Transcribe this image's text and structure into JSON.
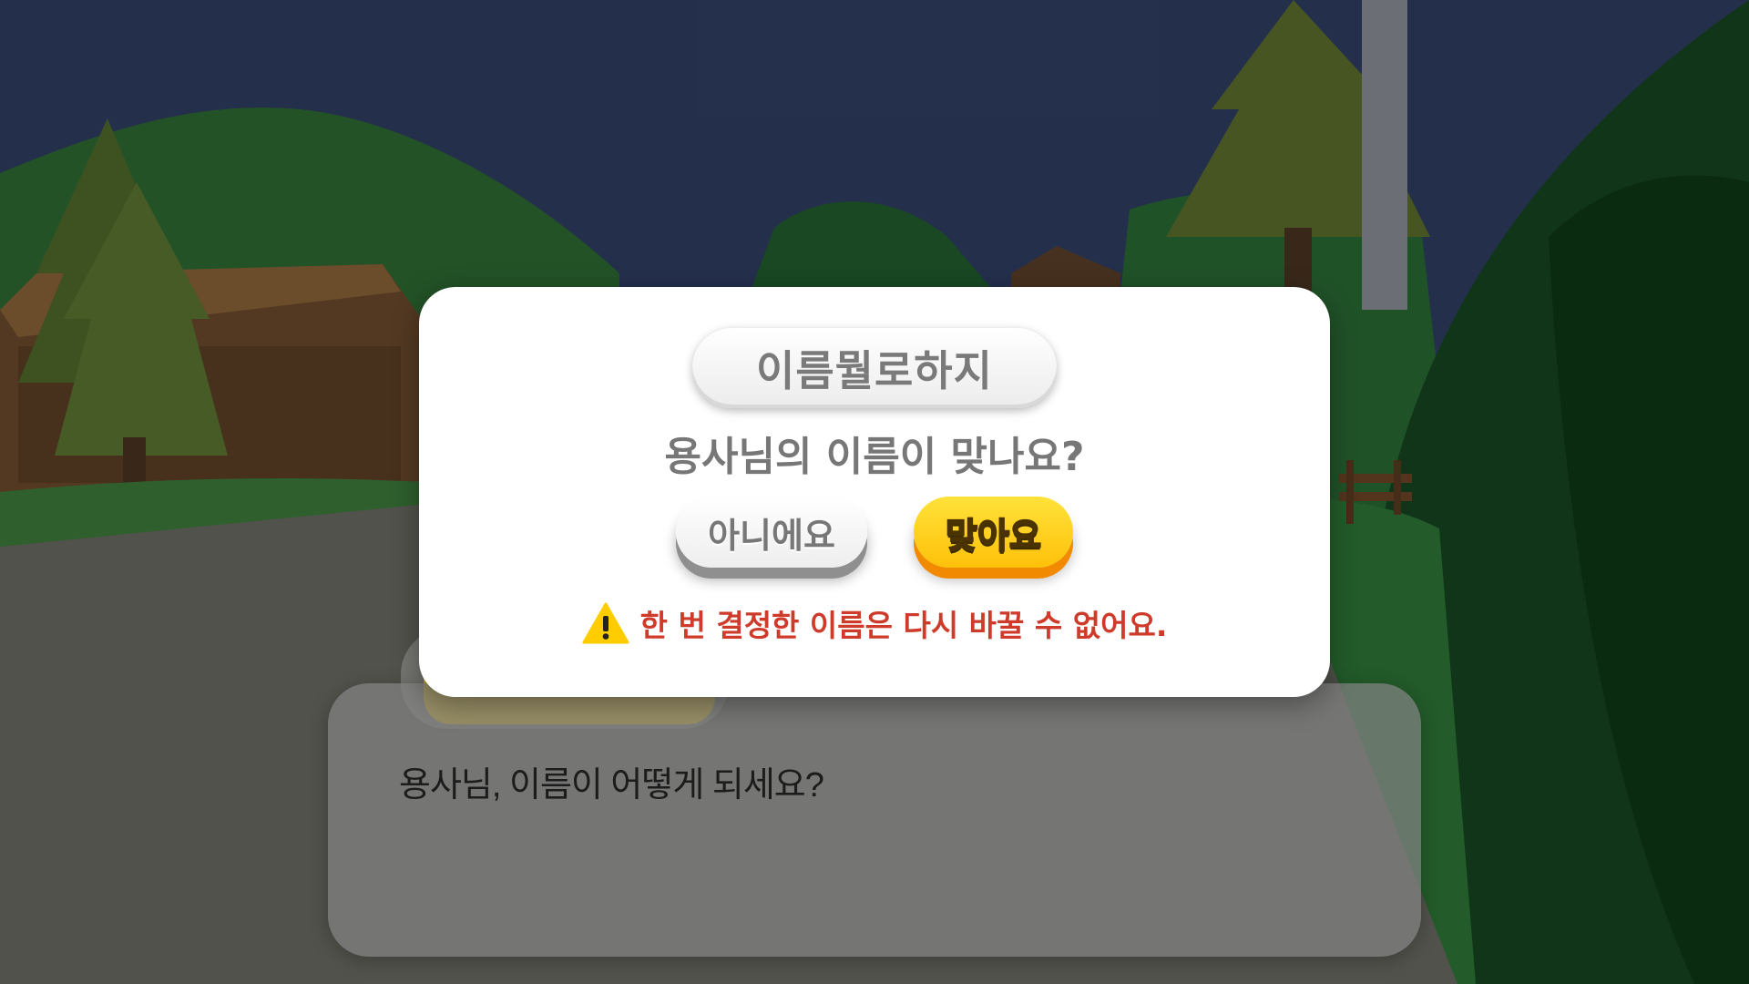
{
  "modal": {
    "name_value": "이름뭘로하지",
    "question": "용사님의 이름이 맞나요?",
    "no_button": "아니에요",
    "yes_button": "맞아요",
    "warning_icon": "warning-triangle-icon",
    "warning_text": "한 번 결정한 이름은 다시 바꿀 수 없어요."
  },
  "dialogue": {
    "text": "용사님, 이름이 어떻게 되세요?"
  },
  "colors": {
    "sky": "#2f3d62",
    "grass_dark": "#1f5a2b",
    "yes_button": "#ffc10a",
    "warning": "#cf3b2a"
  }
}
